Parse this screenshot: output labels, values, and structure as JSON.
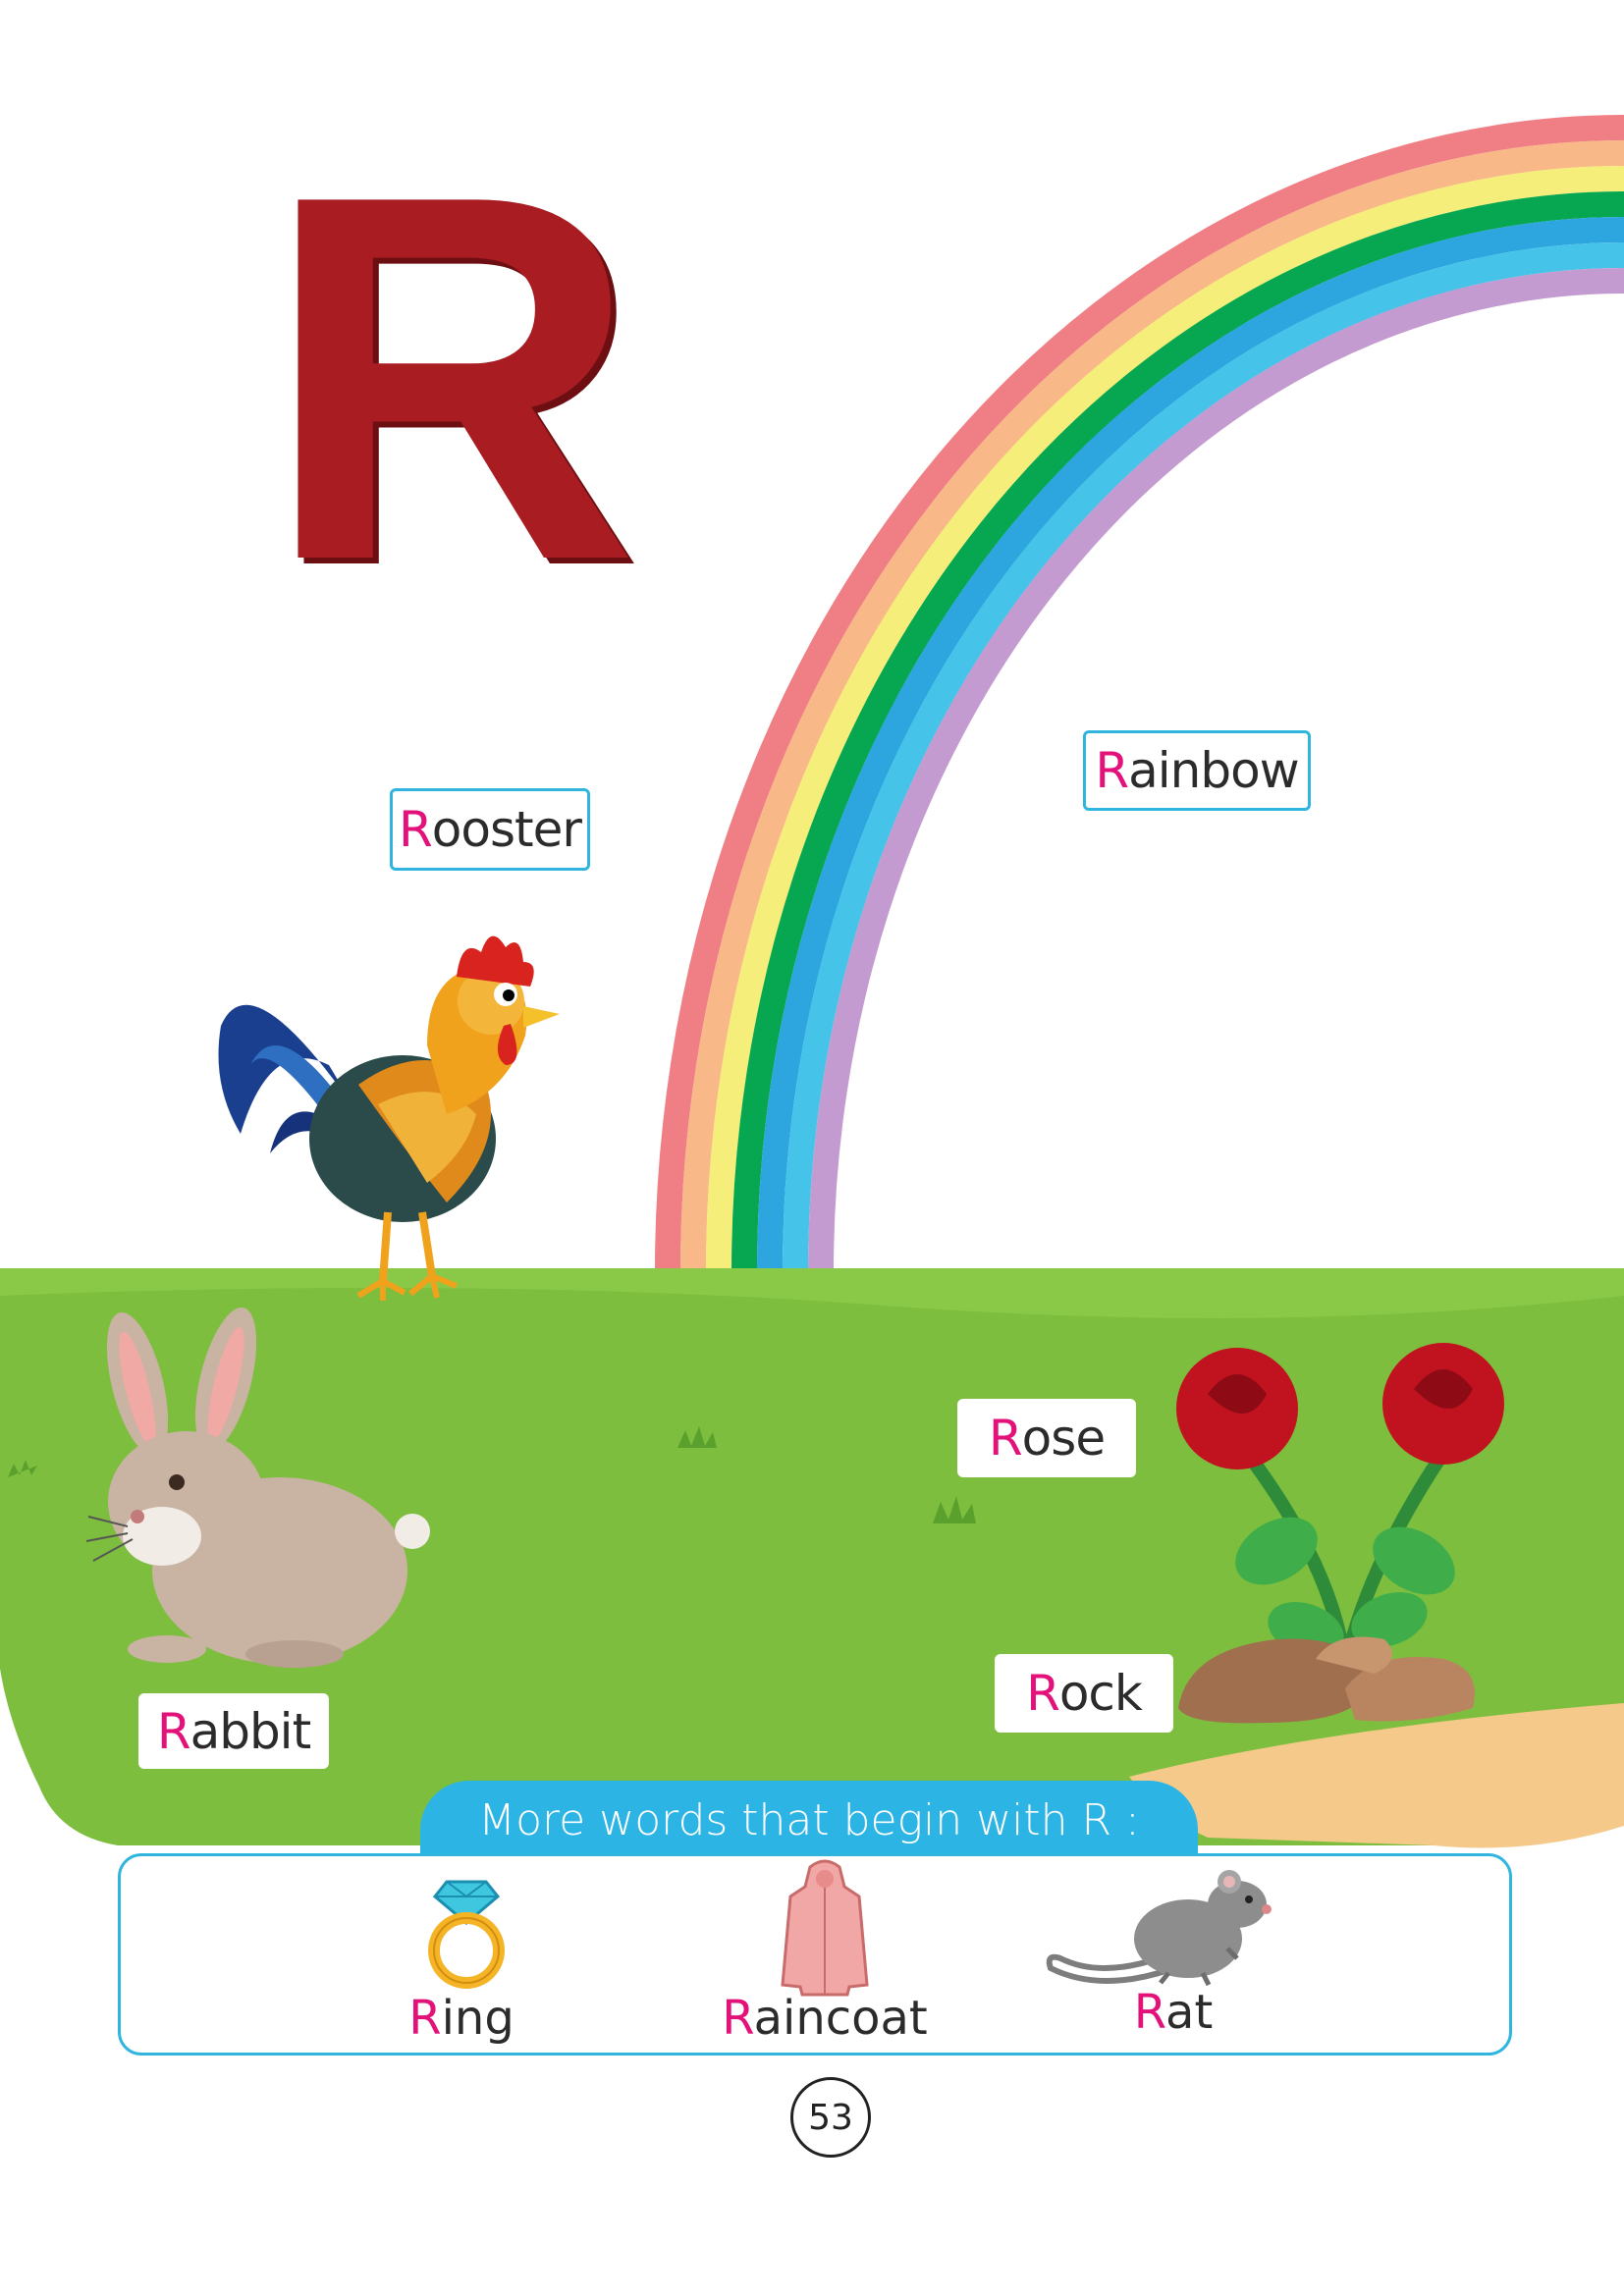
{
  "letter": "R",
  "colors": {
    "letter": "#a81c22",
    "initial_highlight": "#e2127a",
    "label_border": "#2fb5de",
    "grass": "#7dbe3e",
    "banner": "#2cb4e4",
    "rainbow": [
      "#ef7f85",
      "#f8b887",
      "#f6ee7a",
      "#07a650",
      "#2da6df",
      "#46c3e9",
      "#c49bd0"
    ]
  },
  "words": {
    "rooster": {
      "initial": "R",
      "rest": "ooster"
    },
    "rainbow": {
      "initial": "R",
      "rest": "ainbow"
    },
    "rose": {
      "initial": "R",
      "rest": "ose"
    },
    "rabbit": {
      "initial": "R",
      "rest": "abbit"
    },
    "rock": {
      "initial": "R",
      "rest": "ock"
    }
  },
  "more_words": {
    "heading": "More words that begin with R :",
    "items": [
      {
        "initial": "R",
        "rest": "ing",
        "icon": "ring-icon"
      },
      {
        "initial": "R",
        "rest": "aincoat",
        "icon": "raincoat-icon"
      },
      {
        "initial": "R",
        "rest": "at",
        "icon": "rat-icon"
      }
    ]
  },
  "page_number": "53"
}
